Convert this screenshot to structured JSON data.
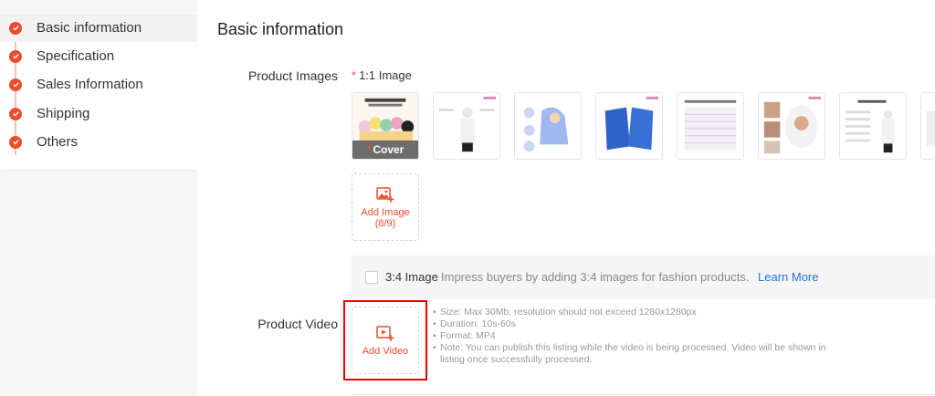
{
  "sidebar": {
    "items": [
      {
        "label": "Basic information",
        "active": true
      },
      {
        "label": "Specification"
      },
      {
        "label": "Sales Information"
      },
      {
        "label": "Shipping"
      },
      {
        "label": "Others"
      }
    ]
  },
  "main": {
    "title": "Basic information",
    "product_images": {
      "label": "Product Images",
      "required_mark": "*",
      "ratio_label": "1:1 Image",
      "cover_label": "Cover",
      "cover_mark": "*",
      "add_image_label": "Add Image",
      "add_image_count": "(8/9)"
    },
    "ratio_34": {
      "title": "3:4 Image",
      "description": "Impress buyers by adding 3:4 images for fashion products.",
      "link": "Learn More"
    },
    "product_video": {
      "label": "Product Video",
      "add_label": "Add Video",
      "guidelines": [
        "Size: Max 30Mb, resolution should not exceed 1280x1280px",
        "Duration: 10s-60s",
        "Format: MP4",
        "Note: You can publish this listing while the video is being processed. Video will be shown in listing once successfully processed."
      ]
    }
  },
  "colors": {
    "accent": "#ee4d2d",
    "link": "#2673dd",
    "highlight": "#e00000"
  },
  "icons": [
    "check-icon",
    "image-add-icon",
    "video-add-icon"
  ]
}
